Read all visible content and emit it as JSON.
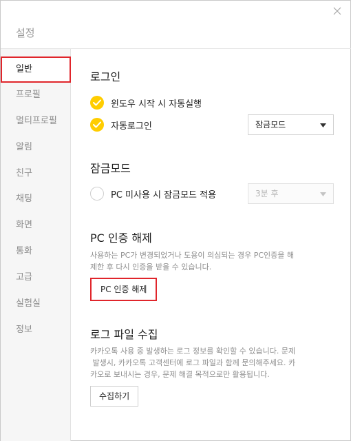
{
  "window": {
    "title": "설정"
  },
  "sidebar": {
    "items": [
      {
        "label": "일반"
      },
      {
        "label": "프로필"
      },
      {
        "label": "멀티프로필"
      },
      {
        "label": "알림"
      },
      {
        "label": "친구"
      },
      {
        "label": "채팅"
      },
      {
        "label": "화면"
      },
      {
        "label": "통화"
      },
      {
        "label": "고급"
      },
      {
        "label": "실험실"
      },
      {
        "label": "정보"
      }
    ],
    "selected": "일반"
  },
  "login": {
    "title": "로그인",
    "auto_start": {
      "label": "윈도우 시작 시 자동실행",
      "checked": true
    },
    "auto_login": {
      "label": "자동로그인",
      "checked": true
    },
    "mode_select": {
      "value": "잠금모드"
    }
  },
  "lock": {
    "title": "잠금모드",
    "idle_lock": {
      "label": "PC 미사용 시 잠금모드 적용",
      "checked": false
    },
    "delay_select": {
      "value": "3분 후",
      "disabled": true
    }
  },
  "pc_auth": {
    "title": "PC 인증 해제",
    "desc_line1": "사용하는 PC가 변경되었거나 도용이 의심되는 경우 PC인증을 해",
    "desc_line2": "제한 후 다시 인증을 받을 수 있습니다.",
    "button": "PC 인증 해제"
  },
  "log": {
    "title": "로그 파일 수집",
    "desc_line1": "카카오톡 사용 중 발생하는 로그 정보를 확인할 수 있습니다. 문제",
    "desc_line2": " 발생시, 카카오톡 고객센터에 로그 파일과 함께 문의해주세요. 카",
    "desc_line3": "카오로 보내시는 경우, 문제 해결 목적으로만 활용됩니다.",
    "button": "수집하기"
  },
  "colors": {
    "accent_yellow": "#ffcd00",
    "highlight_red": "#e0252b",
    "sidebar_bg": "#f6f6f6"
  },
  "icons": {
    "close": "close-icon",
    "check": "check-icon",
    "dropdown": "chevron-down-icon"
  }
}
